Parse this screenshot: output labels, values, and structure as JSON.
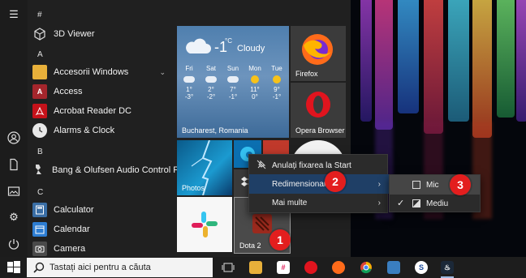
{
  "start_menu": {
    "sections": [
      {
        "letter": "#",
        "apps": [
          {
            "label": "3D Viewer",
            "icon": "cube-icon"
          }
        ]
      },
      {
        "letter": "A",
        "apps": [
          {
            "label": "Accesorii Windows",
            "icon": "folder-icon",
            "expandable": true
          },
          {
            "label": "Access",
            "icon": "access-icon"
          },
          {
            "label": "Acrobat Reader DC",
            "icon": "acrobat-icon"
          },
          {
            "label": "Alarms & Clock",
            "icon": "clock-icon"
          }
        ]
      },
      {
        "letter": "B",
        "apps": [
          {
            "label": "Bang & Olufsen Audio Control Panel",
            "icon": "bang-olufsen-icon"
          }
        ]
      },
      {
        "letter": "C",
        "apps": [
          {
            "label": "Calculator",
            "icon": "calculator-icon"
          },
          {
            "label": "Calendar",
            "icon": "calendar-icon"
          },
          {
            "label": "Camera",
            "icon": "camera-icon"
          }
        ]
      }
    ]
  },
  "weather": {
    "temperature": "-1",
    "unit": "°C",
    "condition": "Cloudy",
    "location": "Bucharest, Romania",
    "days": [
      {
        "day": "Fri",
        "high": "1°",
        "low": "-3°",
        "icon": "cloud"
      },
      {
        "day": "Sat",
        "high": "2°",
        "low": "-2°",
        "icon": "cloud"
      },
      {
        "day": "Sun",
        "high": "7°",
        "low": "-1°",
        "icon": "cloud"
      },
      {
        "day": "Mon",
        "high": "11°",
        "low": "0°",
        "icon": "sun"
      },
      {
        "day": "Tue",
        "high": "9°",
        "low": "-1°",
        "icon": "sun"
      }
    ]
  },
  "tiles": {
    "firefox": "Firefox",
    "opera": "Opera Browser",
    "photos": "Photos",
    "dota": "Dota 2"
  },
  "context_menu": {
    "unpin": "Anulați fixarea la Start",
    "resize": "Redimensionare",
    "more": "Mai multe"
  },
  "resize_menu": {
    "small": "Mic",
    "medium": "Mediu",
    "checked": "medium"
  },
  "badges": {
    "one": "1",
    "two": "2",
    "three": "3"
  },
  "taskbar": {
    "search_placeholder": "Tastați aici pentru a căuta"
  },
  "colors": {
    "badge": "#e31e1e",
    "highlight": "#2f4a6a",
    "accent": "#0a74d4"
  }
}
